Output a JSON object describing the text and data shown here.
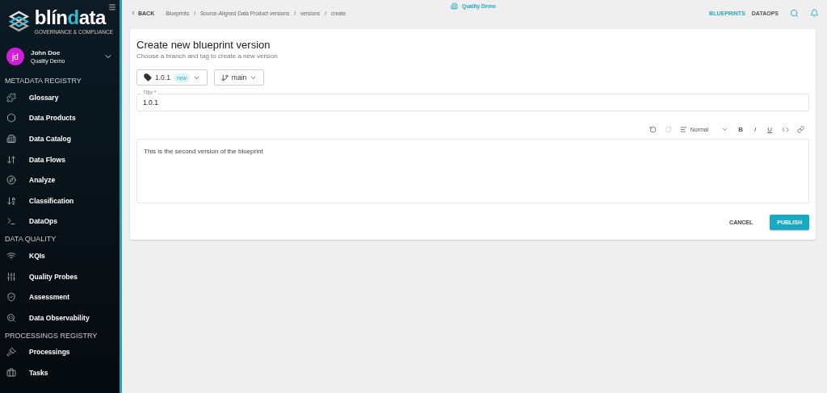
{
  "sidebar": {
    "brand": {
      "name_start": "blín",
      "name_accent": "d",
      "name_end": "ata",
      "tagline": "GOVERNANCE & COMPLIANCE"
    },
    "user": {
      "initials": "jd",
      "name": "John Doe",
      "tenant": "Quality Demo"
    },
    "sections": [
      {
        "title": "METADATA REGISTRY",
        "items": [
          {
            "label": "Glossary"
          },
          {
            "label": "Data Products"
          },
          {
            "label": "Data Catalog"
          },
          {
            "label": "Data Flows"
          },
          {
            "label": "Analyze"
          },
          {
            "label": "Classification"
          },
          {
            "label": "DataOps"
          }
        ]
      },
      {
        "title": "DATA QUALITY",
        "items": [
          {
            "label": "KQIs"
          },
          {
            "label": "Quality Probes"
          },
          {
            "label": "Assessment"
          },
          {
            "label": "Data Observability"
          }
        ]
      },
      {
        "title": "PROCESSINGS REGISTRY",
        "items": [
          {
            "label": "Processings"
          },
          {
            "label": "Tasks"
          }
        ]
      }
    ]
  },
  "topbar": {
    "back": "BACK",
    "breadcrumbs": [
      "Blueprints",
      "Source-Aligned Data Product versions",
      "versions",
      "create"
    ],
    "separator": "/",
    "tenant": "Quality Demo",
    "nav": [
      {
        "label": "BLUEPRINTS",
        "selected": true
      },
      {
        "label": "DATAOPS",
        "selected": false
      }
    ]
  },
  "form": {
    "title": "Create new blueprint version",
    "subtitle": "Choose a branch and tag to create a new version",
    "tag": {
      "value": "1.0.1",
      "badge": "new"
    },
    "branch": {
      "value": "main"
    },
    "title_field": {
      "label": "Title *",
      "value": "1.0.1"
    },
    "editor": {
      "history": [
        {
          "kind": "undo",
          "disabled": false
        },
        {
          "kind": "redo",
          "disabled": true
        }
      ],
      "style": "Normal",
      "format": [
        "B",
        "I",
        "U"
      ],
      "content": "This is the second version of the blueprint"
    },
    "buttons": [
      {
        "label": "CANCEL",
        "kind": "text"
      },
      {
        "label": "PUBLISH",
        "kind": "primary"
      }
    ]
  }
}
